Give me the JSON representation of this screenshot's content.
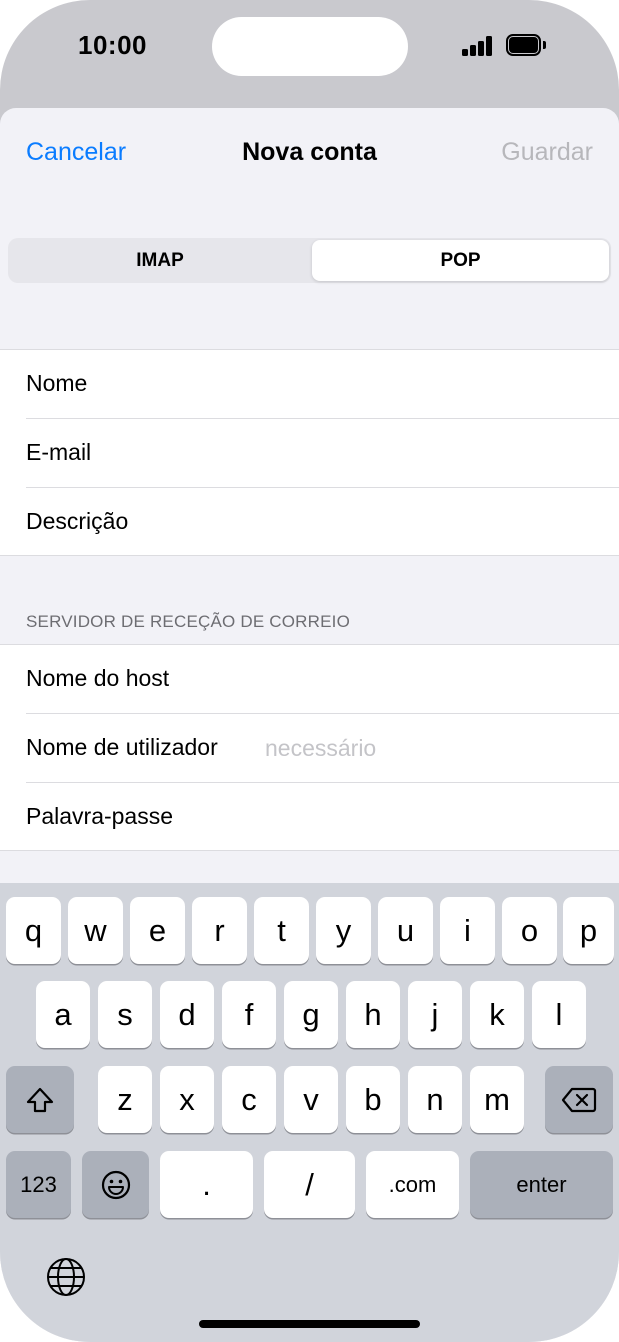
{
  "status": {
    "time": "10:00",
    "icons": [
      "signal-icon",
      "battery-icon"
    ]
  },
  "nav": {
    "cancel": "Cancelar",
    "title": "Nova conta",
    "save": "Guardar"
  },
  "segments": {
    "imap": "IMAP",
    "pop": "POP",
    "selected": "POP"
  },
  "account_fields": [
    {
      "label": "Nome"
    },
    {
      "label": "E-mail"
    },
    {
      "label": "Descrição"
    }
  ],
  "incoming_server": {
    "header": "SERVIDOR DE RECEÇÃO DE CORREIO",
    "fields": [
      {
        "label": "Nome do host"
      },
      {
        "label": "Nome de utilizador",
        "placeholder": "necessário"
      },
      {
        "label": "Palavra-passe"
      }
    ]
  },
  "keyboard": {
    "row1": [
      "q",
      "w",
      "e",
      "r",
      "t",
      "y",
      "u",
      "i",
      "o",
      "p"
    ],
    "row2": [
      "a",
      "s",
      "d",
      "f",
      "g",
      "h",
      "j",
      "k",
      "l"
    ],
    "row3": [
      "z",
      "x",
      "c",
      "v",
      "b",
      "n",
      "m"
    ],
    "numbers": "123",
    "dot": ".",
    "slash": "/",
    "dotcom": ".com",
    "enter": "enter",
    "icons": [
      "shift-icon",
      "delete-icon",
      "emoji-icon",
      "globe-icon"
    ]
  },
  "colors": {
    "accent": "#0a7cff",
    "disabled": "#b7b7bb",
    "keyboard_bg": "#d1d4db"
  }
}
